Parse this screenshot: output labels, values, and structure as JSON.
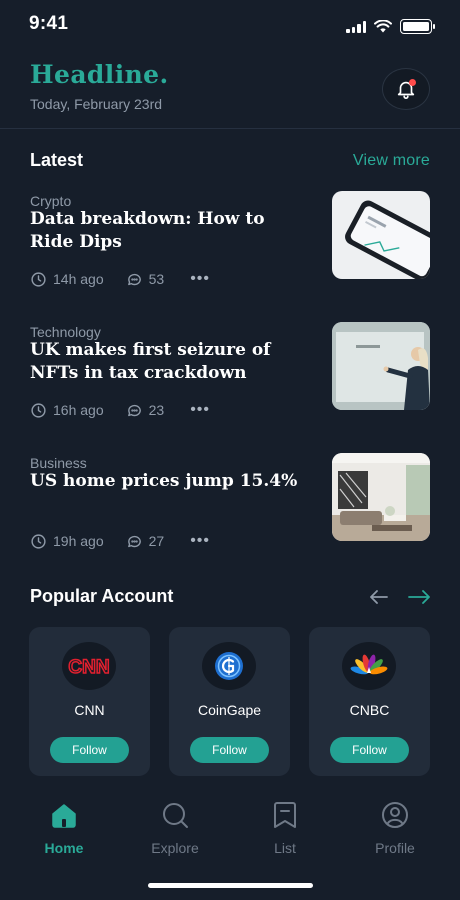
{
  "status_bar": {
    "time": "9:41"
  },
  "header": {
    "title": "Headline.",
    "date": "Today, February 23rd"
  },
  "latest": {
    "title": "Latest",
    "view_more": "View more",
    "items": [
      {
        "category": "Crypto",
        "headline": "Data breakdown: How to Ride Dips",
        "time": "14h ago",
        "comments": "53",
        "more": "•••"
      },
      {
        "category": "Technology",
        "headline": "UK makes first seizure of NFTs in tax crackdown",
        "time": "16h ago",
        "comments": "23",
        "more": "•••"
      },
      {
        "category": "Business",
        "headline": "US home prices jump 15.4%",
        "time": "19h ago",
        "comments": "27",
        "more": "•••"
      }
    ]
  },
  "popular": {
    "title": "Popular Account",
    "accounts": [
      {
        "name": "CNN",
        "follow": "Follow",
        "logo_text": "CNN"
      },
      {
        "name": "CoinGape",
        "follow": "Follow"
      },
      {
        "name": "CNBC",
        "follow": "Follow"
      }
    ]
  },
  "tabs": [
    {
      "label": "Home",
      "icon": "home-icon",
      "active": true
    },
    {
      "label": "Explore",
      "icon": "search-icon",
      "active": false
    },
    {
      "label": "List",
      "icon": "bookmark-icon",
      "active": false
    },
    {
      "label": "Profile",
      "icon": "user-icon",
      "active": false
    }
  ],
  "colors": {
    "background": "#161e2a",
    "accent": "#2aaa98",
    "card": "#222c3a",
    "muted_text": "#8f9aa8",
    "notification_dot": "#ff4b4b"
  }
}
